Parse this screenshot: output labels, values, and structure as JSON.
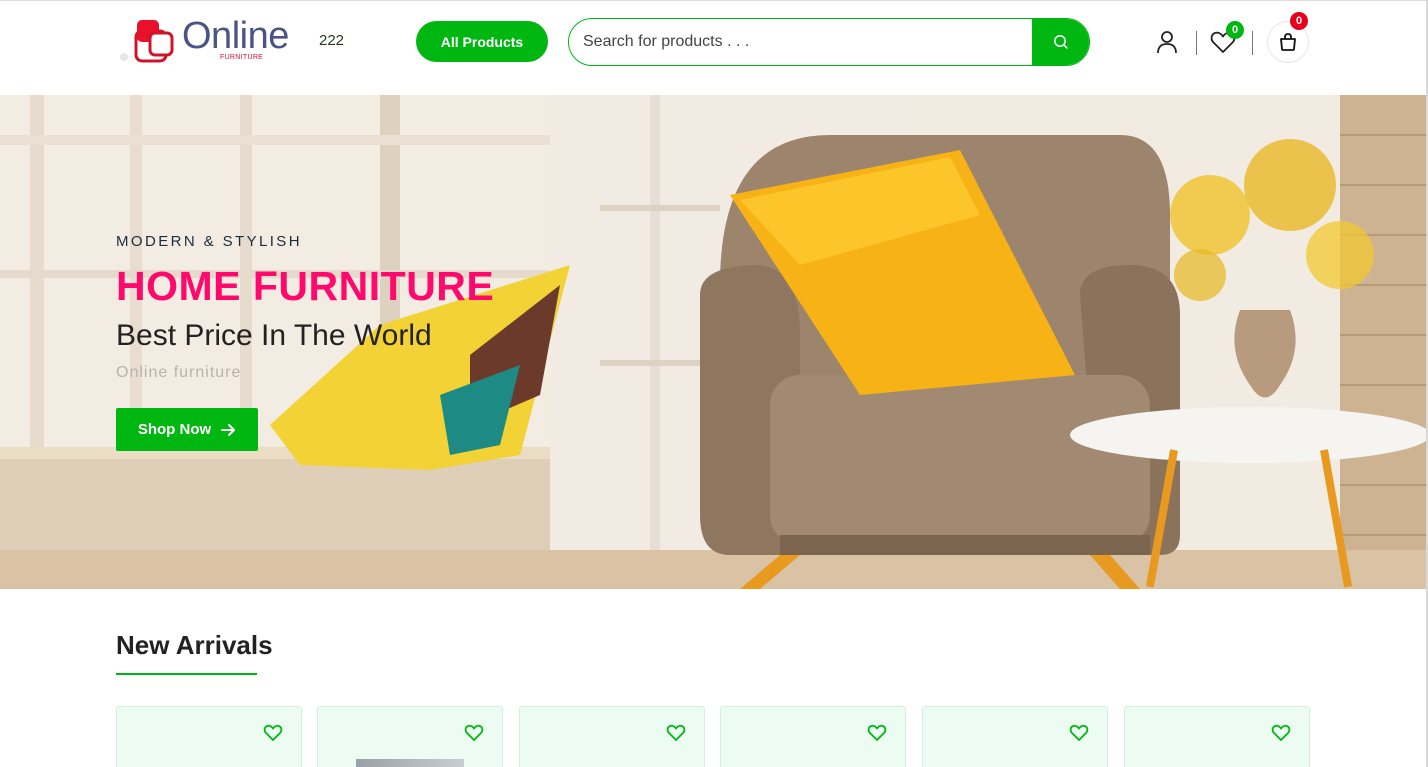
{
  "header": {
    "logo_text": "Online",
    "logo_sub": "FURNITURE",
    "logo_count": "222",
    "all_products_label": "All Products",
    "search_placeholder": "Search for products . . .",
    "wishlist_count": "0",
    "cart_count": "0"
  },
  "hero": {
    "eyebrow": "MODERN & STYLISH",
    "title": "HOME FURNITURE",
    "subtitle": "Best Price In The World",
    "tagline": "Online furniture",
    "cta_label": "Shop Now"
  },
  "new_arrivals": {
    "title": "New Arrivals",
    "cards": [
      {
        "icon": "heart-outline-icon"
      },
      {
        "icon": "heart-outline-icon"
      },
      {
        "icon": "heart-outline-icon"
      },
      {
        "icon": "heart-outline-icon"
      },
      {
        "icon": "heart-outline-icon"
      },
      {
        "icon": "heart-outline-icon"
      }
    ]
  },
  "colors": {
    "accent_green": "#00b711",
    "title_pink": "#ff0a6c",
    "badge_red": "#e8001a",
    "card_bg": "#edfcf3"
  }
}
